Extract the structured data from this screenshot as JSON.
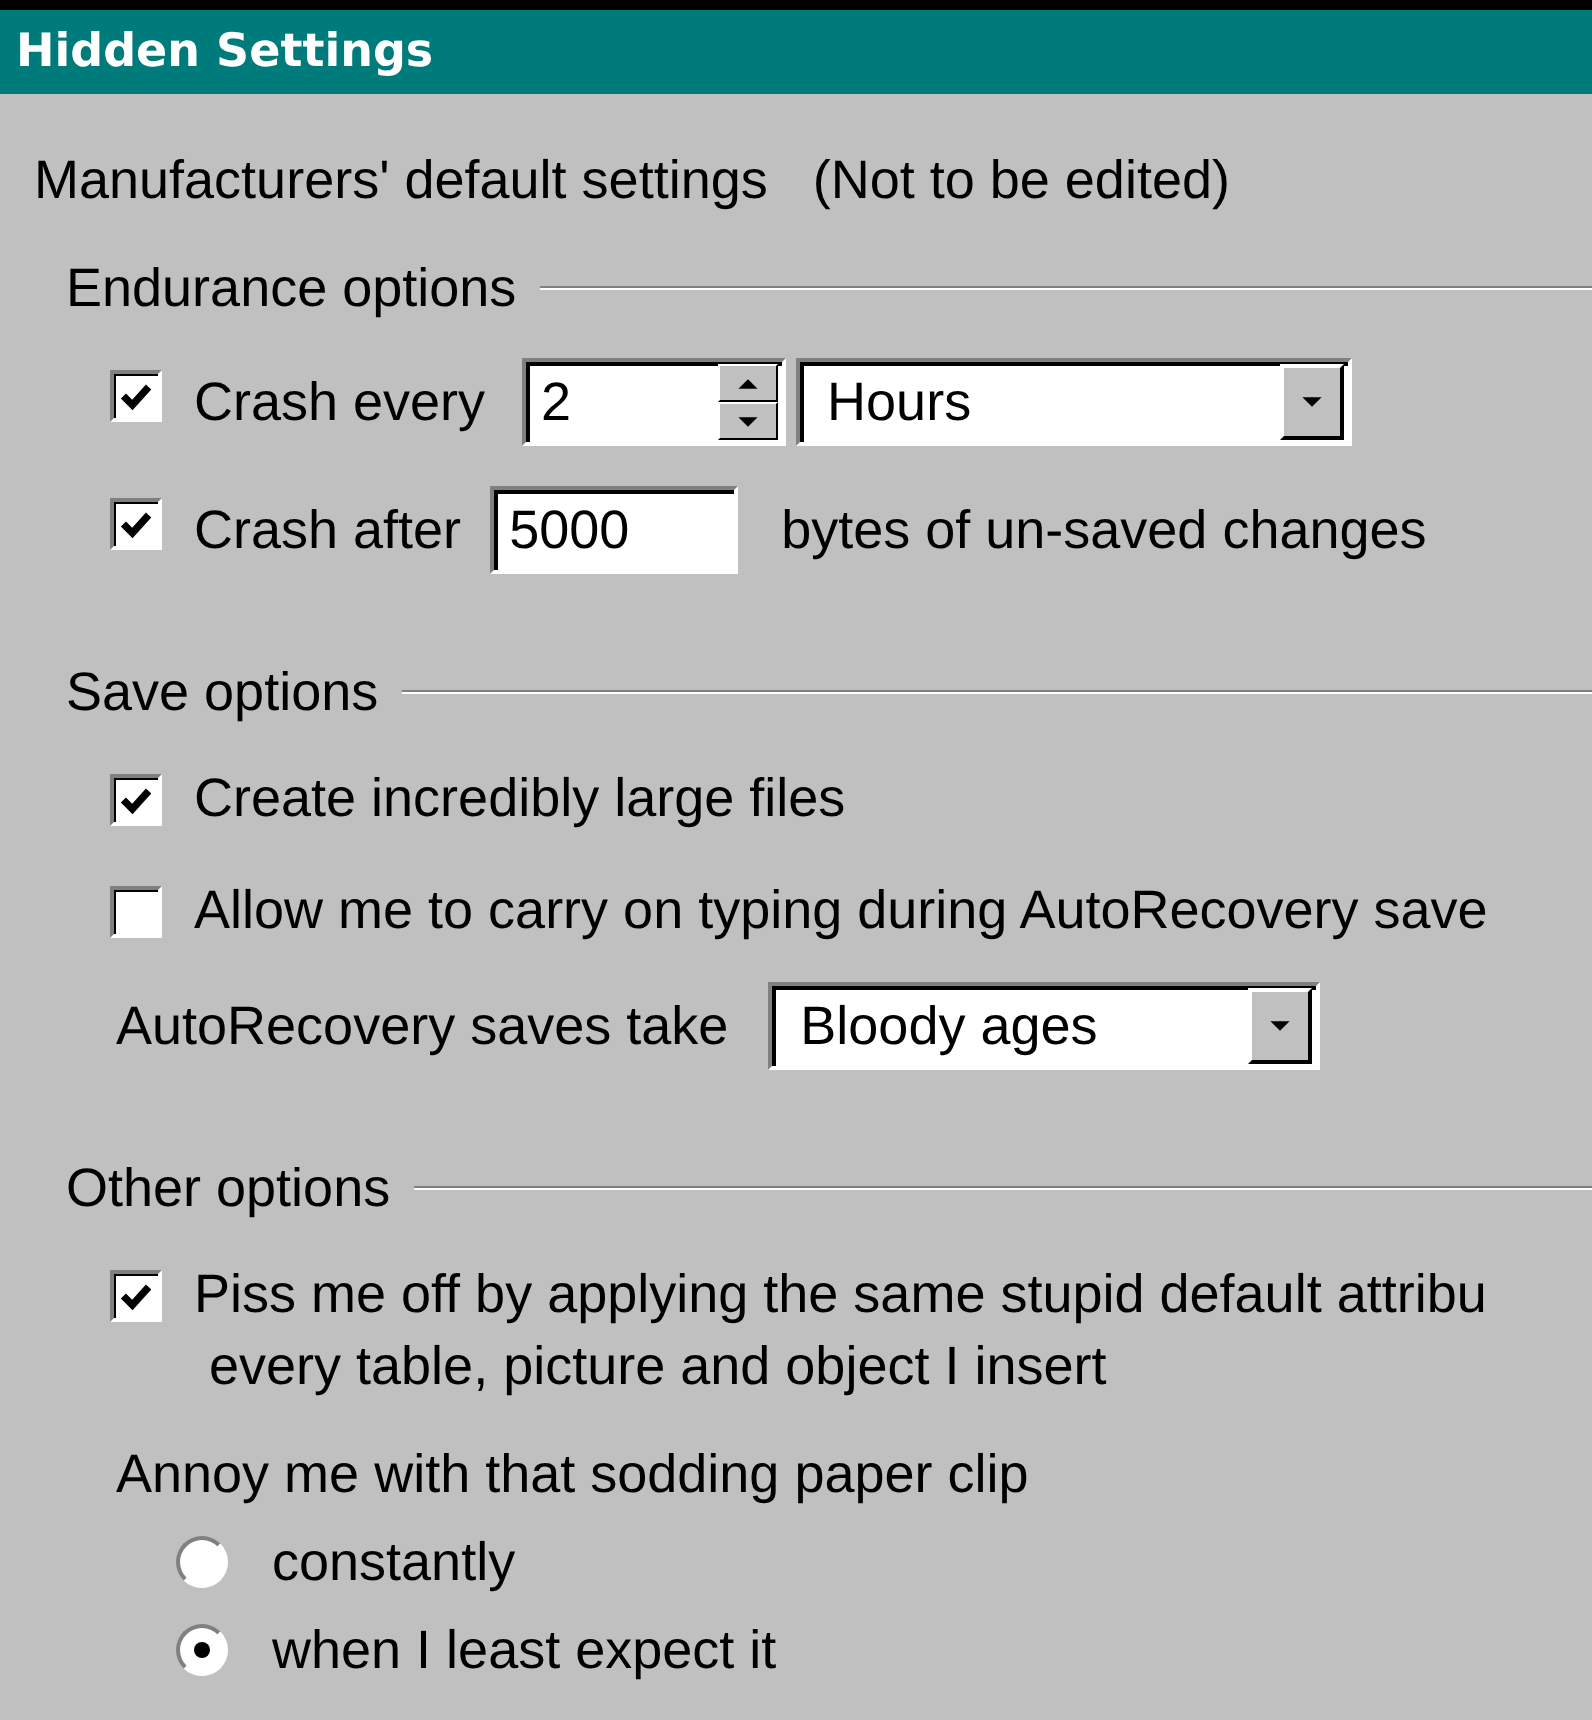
{
  "window": {
    "title": "Hidden Settings"
  },
  "intro": "Manufacturers' default settings   (Not to be edited)",
  "groups": [
    {
      "label": "Endurance options",
      "items": [
        {
          "kind": "checkbox",
          "label": "Crash every",
          "checked": true,
          "spin": {
            "value": "2"
          },
          "dropdown": {
            "value": "Hours"
          }
        },
        {
          "kind": "checkbox",
          "label": "Crash after",
          "checked": true,
          "field": {
            "value": "5000"
          },
          "suffix": "bytes of un-saved changes"
        }
      ]
    },
    {
      "label": "Save options",
      "items": [
        {
          "kind": "checkbox",
          "label": "Create incredibly large files",
          "checked": true
        },
        {
          "kind": "checkbox",
          "label": "Allow me to carry on typing during AutoRecovery save",
          "checked": false
        },
        {
          "kind": "dropdown_row",
          "label": "AutoRecovery saves take",
          "dropdown": {
            "value": "Bloody ages"
          }
        }
      ]
    },
    {
      "label": "Other options",
      "items": [
        {
          "kind": "checkbox",
          "label": "Piss me off by applying the same stupid default attribu\n every table, picture and object I insert",
          "checked": true
        },
        {
          "kind": "radio_group",
          "label": "Annoy me with that sodding paper clip",
          "options": [
            {
              "label": "constantly",
              "selected": false
            },
            {
              "label": "when I least expect it",
              "selected": true
            }
          ]
        }
      ]
    }
  ]
}
